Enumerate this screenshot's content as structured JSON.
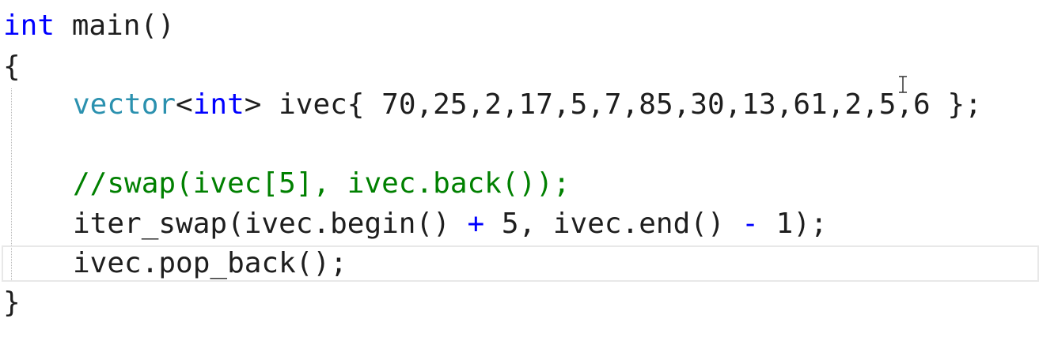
{
  "editor": {
    "lines": {
      "l1": {
        "keyword": "int",
        "rest": " main()"
      },
      "l2": {
        "text": "{"
      },
      "l3": {
        "type": "vector",
        "lt": "<",
        "keyword": "int",
        "rest": "> ivec{ 70,25,2,17,5,7,85,30,13,61,2,5,6 };"
      },
      "l4": {
        "comment": "//swap(ivec[5], ivec.back());"
      },
      "l5": {
        "a": "iter_swap(ivec.begin() ",
        "plus": "+",
        "b": " 5, ivec.end() ",
        "minus": "-",
        "c": " 1);"
      },
      "l6": {
        "text": "ivec.pop_back();"
      },
      "l7": {
        "text": "}"
      }
    },
    "colors": {
      "keyword": "#0000ff",
      "type": "#2b91af",
      "comment": "#008000",
      "text": "#1e1e1e"
    },
    "cursor_icon": "text-cursor-icon"
  }
}
